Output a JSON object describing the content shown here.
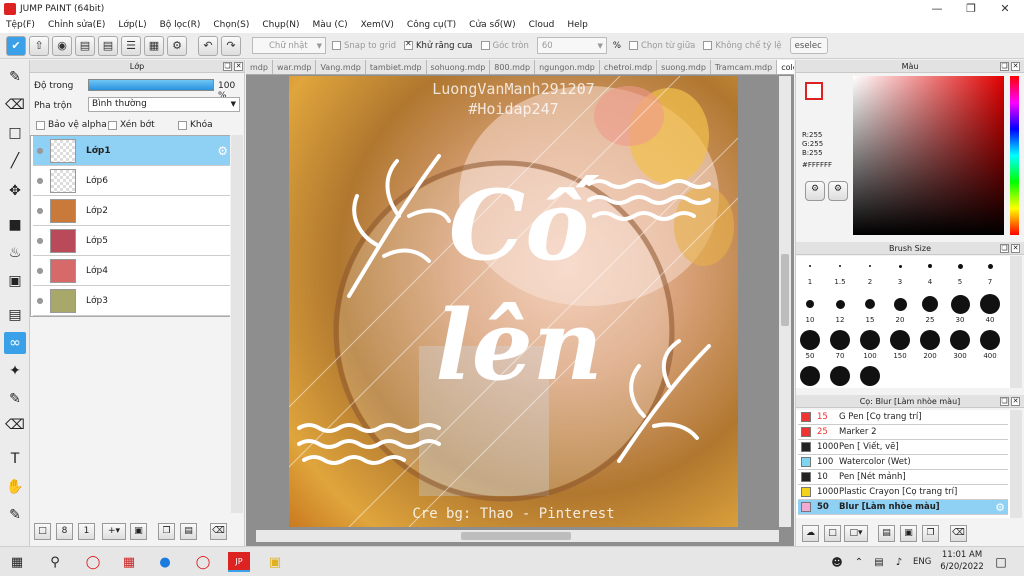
{
  "window": {
    "title": "JUMP PAINT (64bit)"
  },
  "menu": [
    "Tệp(F)",
    "Chỉnh sửa(E)",
    "Lớp(L)",
    "Bộ lọc(R)",
    "Chọn(S)",
    "Chụp(N)",
    "Màu (C)",
    "Xem(V)",
    "Công cụ(T)",
    "Cửa sổ(W)",
    "Cloud",
    "Help"
  ],
  "toolbar": {
    "shape_select": "Chữ nhật",
    "snap_grid": "Snap to grid",
    "antialias": "Khử răng cưa",
    "round_corner": "Góc tròn",
    "round_value": "60",
    "percent": "%",
    "select_center": "Chọn từ giữa",
    "no_ratio": "Không chế tỷ lệ",
    "deselect": "eselec"
  },
  "layer_panel": {
    "title": "Lớp",
    "opacity_label": "Độ trong",
    "opacity_value": "100 %",
    "opacity": 1.0,
    "blend_label": "Pha trộn",
    "blend_value": "Bình thường",
    "protect_alpha": "Bảo vệ alpha",
    "clip": "Xén bớt",
    "lock": "Khóa",
    "layers": [
      {
        "name": "Lớp1",
        "selected": true,
        "thumb": "transparent"
      },
      {
        "name": "Lớp6",
        "selected": false,
        "thumb": "transparent"
      },
      {
        "name": "Lớp2",
        "selected": false,
        "thumb": "#c97a3a"
      },
      {
        "name": "Lớp5",
        "selected": false,
        "thumb": "#b84a5a"
      },
      {
        "name": "Lớp4",
        "selected": false,
        "thumb": "#d66a6a"
      },
      {
        "name": "Lớp3",
        "selected": false,
        "thumb": "#a8a86a"
      }
    ]
  },
  "tabs": [
    "mdp",
    "war.mdp",
    "Vang.mdp",
    "tambiet.mdp",
    "sohuong.mdp",
    "800.mdp",
    "ngungon.mdp",
    "chetroi.mdp",
    "suong.mdp",
    "Tramcam.mdp",
    "colen.mdp"
  ],
  "active_tab": "colen.mdp",
  "artwork": {
    "watermark1": "LuongVanManh291207",
    "watermark2": "#Hoidap247",
    "word1": "Cố",
    "word2": "lên",
    "credit": "Cre bg: Thao - Pinterest"
  },
  "color_panel": {
    "title": "Màu",
    "r": "R:255",
    "g": "G:255",
    "b": "B:255",
    "hex": "#FFFFFF",
    "fg_color": "#ffffff"
  },
  "brush_size": {
    "title": "Brush Size",
    "sizes": [
      "1",
      "1.5",
      "2",
      "3",
      "4",
      "5",
      "7",
      "10",
      "12",
      "15",
      "20",
      "25",
      "30",
      "40",
      "50",
      "70",
      "100",
      "150",
      "200",
      "300",
      "400",
      "",
      "",
      ""
    ]
  },
  "brush_list": {
    "title": "Cọ: Blur [Làm nhòe màu]",
    "items": [
      {
        "size": "15",
        "name": "G Pen [Cọ trang trí]",
        "color": "#e33",
        "size_color": "#e33"
      },
      {
        "size": "25",
        "name": "Marker 2",
        "color": "#e33",
        "size_color": "#e33"
      },
      {
        "size": "1000",
        "name": "Pen [ Viết, vẽ]",
        "color": "#222",
        "size_color": "#222"
      },
      {
        "size": "100",
        "name": "Watercolor (Wet)",
        "color": "#7fd4f0",
        "size_color": "#222"
      },
      {
        "size": "10",
        "name": "Pen [Nét mảnh]",
        "color": "#222",
        "size_color": "#222"
      },
      {
        "size": "1000",
        "name": "Plastic Crayon [Cọ trang trí]",
        "color": "#f2d21a",
        "size_color": "#222"
      },
      {
        "size": "50",
        "name": "Blur [Làm nhòe màu]",
        "color": "#f4a8d4",
        "size_color": "#222",
        "selected": true
      }
    ]
  },
  "taskbar": {
    "lang": "ENG",
    "time": "11:01 AM",
    "date": "6/20/2022"
  }
}
